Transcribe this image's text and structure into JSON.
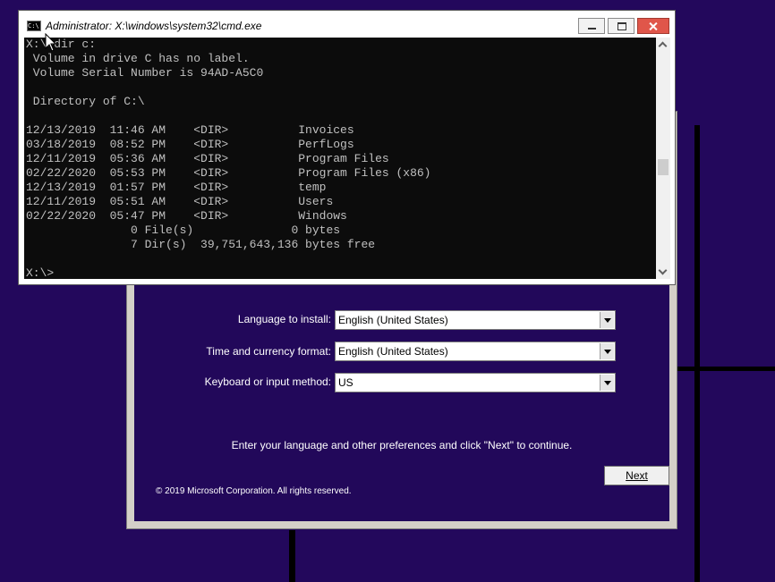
{
  "cmd": {
    "title": "Administrator: X:\\windows\\system32\\cmd.exe",
    "icon_text": "C:\\",
    "lines": [
      "X:\\>dir c:",
      " Volume in drive C has no label.",
      " Volume Serial Number is 94AD-A5C0",
      "",
      " Directory of C:\\",
      "",
      "12/13/2019  11:46 AM    <DIR>          Invoices",
      "03/18/2019  08:52 PM    <DIR>          PerfLogs",
      "12/11/2019  05:36 AM    <DIR>          Program Files",
      "02/22/2020  05:53 PM    <DIR>          Program Files (x86)",
      "12/13/2019  01:57 PM    <DIR>          temp",
      "12/11/2019  05:51 AM    <DIR>          Users",
      "02/22/2020  05:47 PM    <DIR>          Windows",
      "               0 File(s)              0 bytes",
      "               7 Dir(s)  39,751,643,136 bytes free",
      "",
      "X:\\>"
    ]
  },
  "setup": {
    "language_label": "Language to install:",
    "language_value": "English (United States)",
    "time_label": "Time and currency format:",
    "time_value": "English (United States)",
    "keyboard_label": "Keyboard or input method:",
    "keyboard_value": "US",
    "hint": "Enter your language and other preferences and click \"Next\" to continue.",
    "copyright": "© 2019 Microsoft Corporation. All rights reserved.",
    "next_label": "Next"
  },
  "colors": {
    "desktop": "#23085c",
    "console_bg": "#0c0c0c",
    "console_text": "#c0c0c0",
    "close_button": "#e0564a"
  }
}
